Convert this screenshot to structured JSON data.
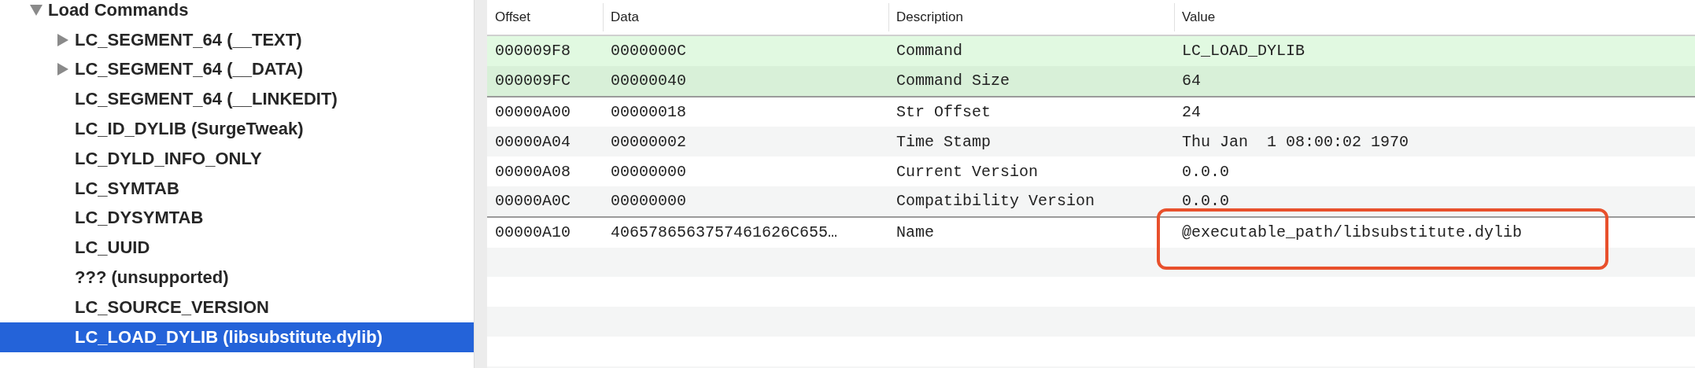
{
  "tree": {
    "label": "Load Commands",
    "expanded": true,
    "children": [
      {
        "label": "LC_SEGMENT_64 (__TEXT)",
        "expandable": true,
        "selected": false
      },
      {
        "label": "LC_SEGMENT_64 (__DATA)",
        "expandable": true,
        "selected": false
      },
      {
        "label": "LC_SEGMENT_64 (__LINKEDIT)",
        "expandable": false,
        "selected": false
      },
      {
        "label": "LC_ID_DYLIB (SurgeTweak)",
        "expandable": false,
        "selected": false
      },
      {
        "label": "LC_DYLD_INFO_ONLY",
        "expandable": false,
        "selected": false
      },
      {
        "label": "LC_SYMTAB",
        "expandable": false,
        "selected": false
      },
      {
        "label": "LC_DYSYMTAB",
        "expandable": false,
        "selected": false
      },
      {
        "label": "LC_UUID",
        "expandable": false,
        "selected": false
      },
      {
        "label": "??? (unsupported)",
        "expandable": false,
        "selected": false
      },
      {
        "label": "LC_SOURCE_VERSION",
        "expandable": false,
        "selected": false
      },
      {
        "label": "LC_LOAD_DYLIB (libsubstitute.dylib)",
        "expandable": false,
        "selected": true
      }
    ]
  },
  "table": {
    "columns": [
      "Offset",
      "Data",
      "Description",
      "Value"
    ],
    "groups": [
      {
        "kind": "command",
        "rows": [
          {
            "offset": "000009F8",
            "data": "0000000C",
            "description": "Command",
            "value": "LC_LOAD_DYLIB",
            "marked": false
          },
          {
            "offset": "000009FC",
            "data": "00000040",
            "description": "Command Size",
            "value": "64",
            "marked": false
          }
        ]
      },
      {
        "kind": "field",
        "rows": [
          {
            "offset": "00000A00",
            "data": "00000018",
            "description": "Str Offset",
            "value": "24",
            "marked": false
          },
          {
            "offset": "00000A04",
            "data": "00000002",
            "description": "Time Stamp",
            "value": "Thu Jan  1 08:00:02 1970",
            "marked": false
          },
          {
            "offset": "00000A08",
            "data": "00000000",
            "description": "Current Version",
            "value": "0.0.0",
            "marked": false
          },
          {
            "offset": "00000A0C",
            "data": "00000000",
            "description": "Compatibility Version",
            "value": "0.0.0",
            "marked": false
          }
        ]
      },
      {
        "kind": "field",
        "rows": [
          {
            "offset": "00000A10",
            "data": "4065786563757461626C655…",
            "description": "Name",
            "value": "@executable_path/libsubstitute.dylib",
            "marked": true
          }
        ]
      }
    ]
  }
}
